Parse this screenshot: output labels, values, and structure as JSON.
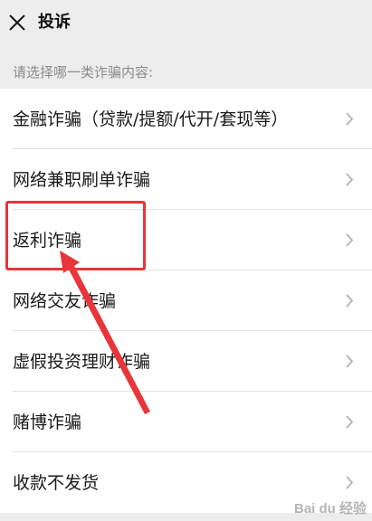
{
  "header": {
    "title": "投诉",
    "close_icon": "close-icon"
  },
  "prompt": "请选择哪一类诈骗内容:",
  "items": [
    {
      "label": "金融诈骗（贷款/提额/代开/套现等）"
    },
    {
      "label": "网络兼职刷单诈骗"
    },
    {
      "label": "返利诈骗"
    },
    {
      "label": "网络交友诈骗"
    },
    {
      "label": "虚假投资理财诈骗"
    },
    {
      "label": "赌博诈骗"
    },
    {
      "label": "收款不发货"
    }
  ],
  "annotation": {
    "color": "#e8353a"
  },
  "watermark": "Bai du 经验"
}
